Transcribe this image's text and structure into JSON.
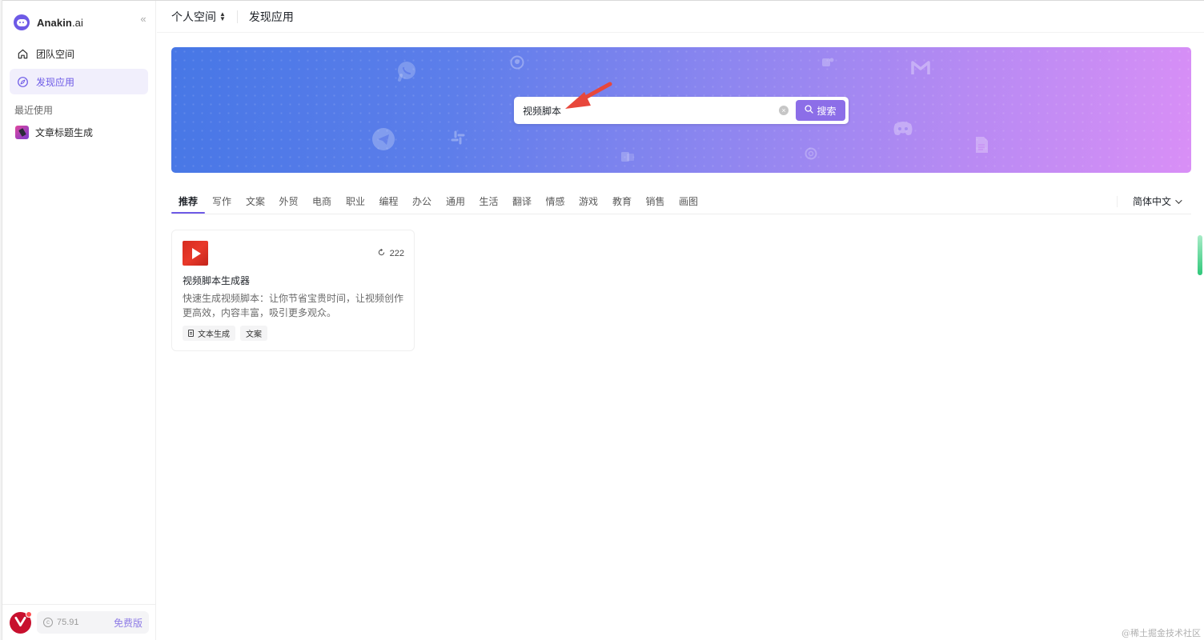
{
  "app": {
    "brand_name": "Anakin",
    "brand_suffix": ".ai",
    "collapse_glyph": "«"
  },
  "sidebar": {
    "nav": [
      {
        "label": "团队空间",
        "icon": "home-icon",
        "active": false
      },
      {
        "label": "发现应用",
        "icon": "compass-icon",
        "active": true
      }
    ],
    "recent_title": "最近使用",
    "recent": [
      {
        "label": "文章标题生成",
        "icon": "app-thumbnail-icon"
      }
    ],
    "footer": {
      "credits": "75.91",
      "plan": "免费版"
    }
  },
  "header": {
    "workspace": "个人空间",
    "page_title": "发现应用"
  },
  "hero": {
    "search": {
      "value": "视频脚本",
      "button_label": "搜索"
    },
    "decorative_icons": [
      "whatsapp-icon",
      "github-icon",
      "teams-icon",
      "gmail-icon",
      "telegram-icon",
      "slack-icon",
      "outlook-icon",
      "openai-icon",
      "discord-icon",
      "google-docs-icon"
    ]
  },
  "tabs": {
    "items": [
      "推荐",
      "写作",
      "文案",
      "外贸",
      "电商",
      "职业",
      "编程",
      "办公",
      "通用",
      "生活",
      "翻译",
      "情感",
      "游戏",
      "教育",
      "销售",
      "画图"
    ],
    "active_index": 0,
    "language": "简体中文"
  },
  "results": [
    {
      "title": "视频脚本生成器",
      "description": "快速生成视频脚本：让你节省宝贵时间，让视频创作更高效，内容丰富，吸引更多观众。",
      "runs": "222",
      "tags": [
        "文本生成",
        "文案"
      ]
    }
  ],
  "watermark": "@稀土掘金技术社区",
  "colors": {
    "accent": "#6d5ae6",
    "search_button": "#8c6ee8",
    "hero_gradient_start": "#4777e6",
    "hero_gradient_end": "#d98ff6",
    "annotation_arrow": "#e8473b"
  }
}
